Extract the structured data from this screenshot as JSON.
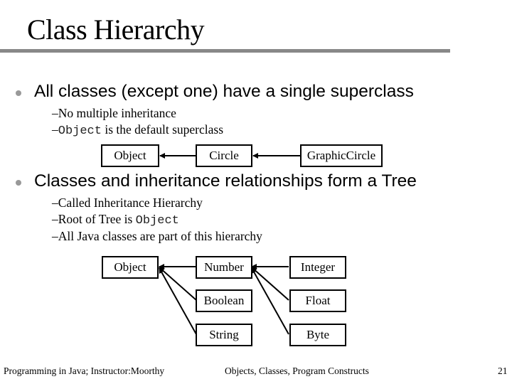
{
  "slide": {
    "title": "Class Hierarchy",
    "bullets": [
      {
        "text": "All classes (except one) have a single superclass",
        "subs": [
          {
            "dash": "–",
            "text": "No multiple inheritance"
          },
          {
            "dash": "–",
            "code": "Object",
            "text": " is the default superclass"
          }
        ]
      },
      {
        "text": "Classes and inheritance relationships form a Tree",
        "subs": [
          {
            "dash": "–",
            "text": "Called Inheritance Hierarchy"
          },
          {
            "dash": "–",
            "text": "Root of Tree is ",
            "code": "Object"
          },
          {
            "dash": "–",
            "text": "All Java classes are part of this hierarchy"
          }
        ]
      }
    ],
    "diagram1": {
      "nodes": [
        "Object",
        "Circle",
        "GraphicCircle"
      ],
      "edges": [
        [
          "Circle",
          "Object"
        ],
        [
          "GraphicCircle",
          "Circle"
        ]
      ]
    },
    "diagram2": {
      "nodes": [
        "Object",
        "Number",
        "Boolean",
        "String",
        "Integer",
        "Float",
        "Byte"
      ],
      "edges": [
        [
          "Number",
          "Object"
        ],
        [
          "Boolean",
          "Object"
        ],
        [
          "String",
          "Object"
        ],
        [
          "Integer",
          "Number"
        ],
        [
          "Float",
          "Number"
        ],
        [
          "Byte",
          "Number"
        ]
      ]
    },
    "footer": {
      "left": "Programming in Java; Instructor:Moorthy",
      "center": "Objects, Classes, Program Constructs",
      "page": "21"
    }
  }
}
